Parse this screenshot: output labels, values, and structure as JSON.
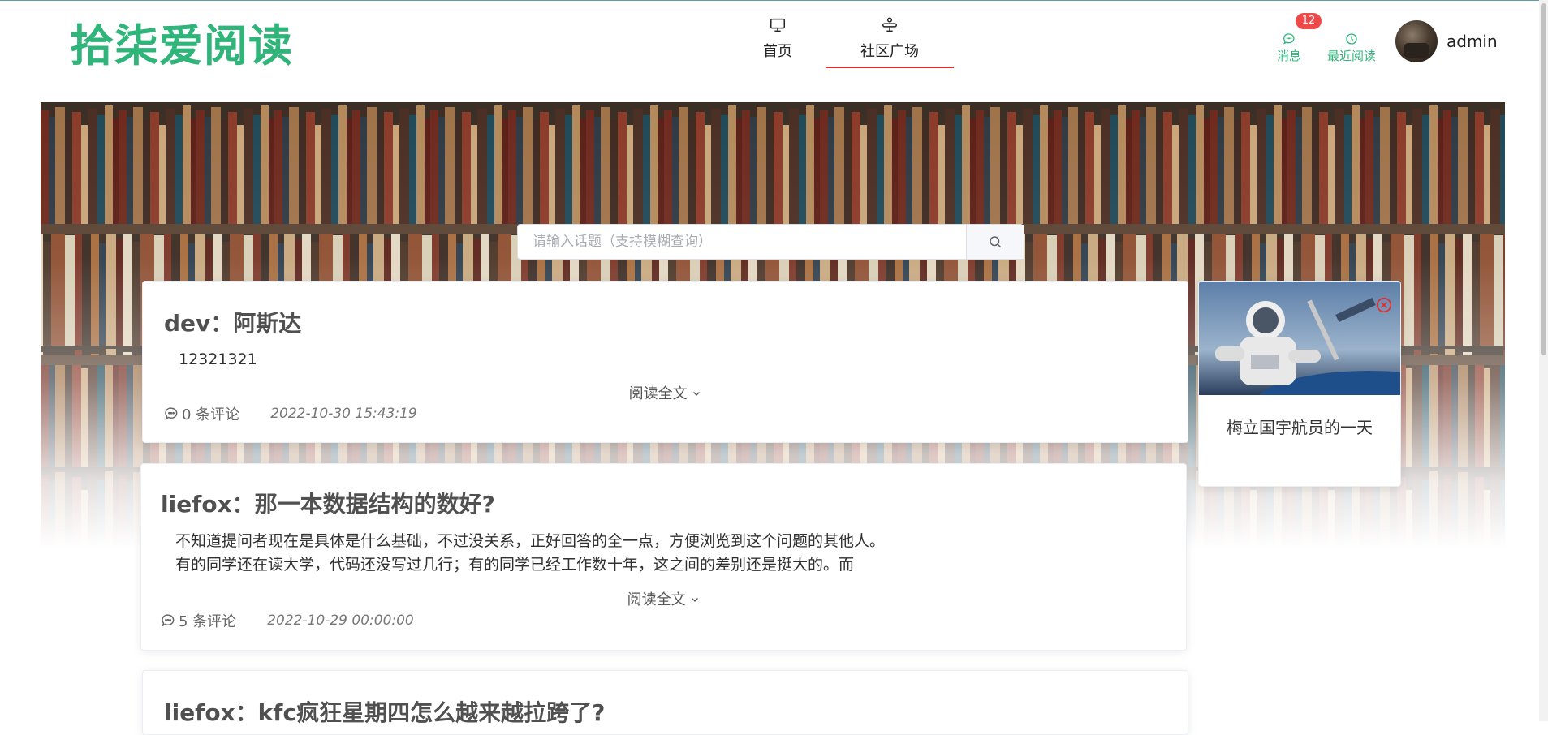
{
  "header": {
    "logo": "拾柒爱阅读",
    "nav": [
      {
        "label": "首页",
        "icon": "monitor-icon"
      },
      {
        "label": "社区广场",
        "icon": "community-icon",
        "active": true
      }
    ],
    "messages_label": "消息",
    "messages_badge": "12",
    "recent_label": "最近阅读",
    "username": "admin"
  },
  "search": {
    "placeholder": "请输入话题（支持模糊查询）"
  },
  "posts": [
    {
      "title": "dev：阿斯达",
      "body_lines": [
        "12321321"
      ],
      "read_more": "阅读全文",
      "comments": "0 条评论",
      "date": "2022-10-30 15:43:19"
    },
    {
      "title": "liefox：那一本数据结构的数好?",
      "body_lines": [
        "不知道提问者现在是具体是什么基础，不过没关系，正好回答的全一点，方便浏览到这个问题的其他人。",
        "有的同学还在读大学，代码还没写过几行；有的同学已经工作数十年，这之间的差别还是挺大的。而"
      ],
      "read_more": "阅读全文",
      "comments": "5 条评论",
      "date": "2022-10-29 00:00:00"
    },
    {
      "title": "liefox：kfc疯狂星期四怎么越来越拉跨了?"
    }
  ],
  "ad": {
    "caption": "梅立国宇航员的一天"
  },
  "colors": {
    "brand": "#2fb57a",
    "active_underline": "#e32b2b",
    "badge": "#ef4a4a"
  }
}
